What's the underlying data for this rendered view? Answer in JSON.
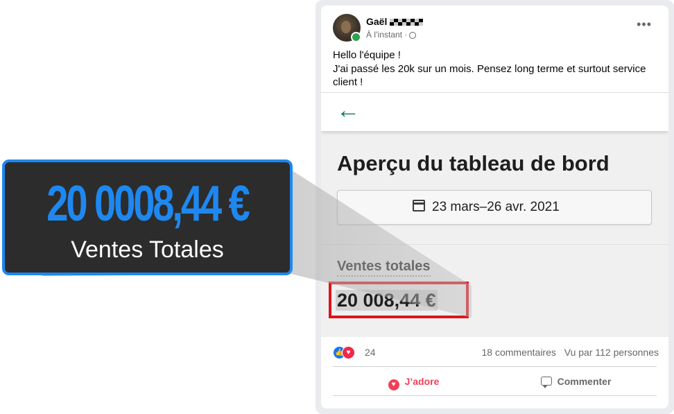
{
  "post": {
    "author_first_name": "Gaël",
    "timestamp": "À l’instant ·",
    "more_options": "•••",
    "text_lines": [
      "Hello l'équipe !",
      "J'ai passé les 20k sur un mois. Pensez long terme et surtout service",
      "client !"
    ]
  },
  "screenshot": {
    "back_arrow": "←",
    "title": "Aperçu du tableau de bord",
    "date_range": "23 mars–26 avr. 2021",
    "sales_label": "Ventes totales",
    "sales_value": "20 008,44 €"
  },
  "reactions": {
    "count": "24",
    "comments": "18 commentaires",
    "views": "Vu par 112 personnes",
    "icons": [
      "like-icon",
      "love-icon"
    ]
  },
  "actions": {
    "love_label": "J’adore",
    "comment_label": "Commenter"
  },
  "callout": {
    "amount": "20 0008,44 €",
    "caption": "Ventes Totales"
  },
  "colors": {
    "accent_blue": "#1e88f0",
    "highlight_red": "#e0141b",
    "love_red": "#f33e58",
    "back_arrow_green": "#0f7a5a"
  }
}
